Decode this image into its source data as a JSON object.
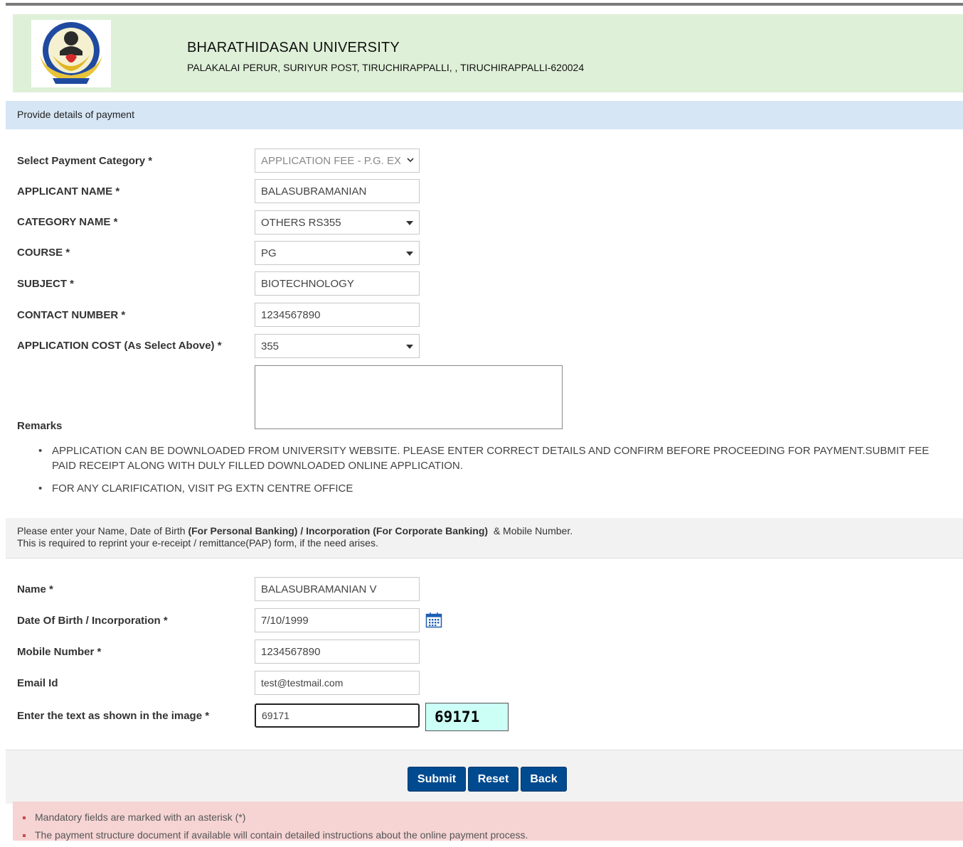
{
  "header": {
    "university_name": "BHARATHIDASAN UNIVERSITY",
    "address": "PALAKALAI PERUR, SURIYUR POST, TIRUCHIRAPPALLI, , TIRUCHIRAPPALLI-620024"
  },
  "section_title": "Provide details of payment",
  "payment_form": {
    "payment_category": {
      "label": "Select Payment Category *",
      "value": "APPLICATION FEE - P.G. EX"
    },
    "applicant_name": {
      "label": "APPLICANT NAME *",
      "value": "BALASUBRAMANIAN"
    },
    "category_name": {
      "label": "CATEGORY NAME *",
      "value": "OTHERS RS355"
    },
    "course": {
      "label": "COURSE *",
      "value": "PG"
    },
    "subject": {
      "label": "SUBJECT *",
      "value": "BIOTECHNOLOGY"
    },
    "contact_number": {
      "label": "CONTACT NUMBER *",
      "value": "1234567890"
    },
    "application_cost": {
      "label": "APPLICATION COST (As Select Above) *",
      "value": "355"
    },
    "remarks": {
      "label": "Remarks",
      "value": ""
    }
  },
  "instructions": [
    "APPLICATION CAN BE DOWNLOADED FROM UNIVERSITY WEBSITE. PLEASE ENTER CORRECT DETAILS AND CONFIRM BEFORE PROCEEDING FOR PAYMENT.SUBMIT FEE PAID RECEIPT ALONG WITH DULY FILLED DOWNLOADED ONLINE APPLICATION.",
    "FOR ANY CLARIFICATION, VISIT PG EXTN CENTRE OFFICE"
  ],
  "info": {
    "line1_start": "Please enter your Name, Date of Birth ",
    "line1_bold": "(For Personal Banking) / Incorporation (For Corporate Banking)",
    "line1_end": "  & Mobile Number.",
    "line2": "This is required to reprint your e-receipt / remittance(PAP) form, if the need arises."
  },
  "personal_form": {
    "name": {
      "label": "Name *",
      "value": "BALASUBRAMANIAN V"
    },
    "dob": {
      "label": "Date Of Birth / Incorporation *",
      "value": "7/10/1999",
      "icon": "calendar-icon"
    },
    "mobile": {
      "label": "Mobile Number *",
      "value": "1234567890"
    },
    "email": {
      "label": "Email Id",
      "value": "test@testmail.com"
    },
    "captcha": {
      "label": "Enter the text as shown in the image *",
      "value": "69171",
      "image_text": "69171"
    }
  },
  "buttons": {
    "submit": "Submit",
    "reset": "Reset",
    "back": "Back"
  },
  "notes": [
    "Mandatory fields are marked with an asterisk (*)",
    "The payment structure document if available will contain detailed instructions about the online payment process."
  ],
  "colors": {
    "header_bg": "#dff0d8",
    "section_bg": "#d6e6f5",
    "button_bg": "#004a8f",
    "notes_bg": "#f6d4d4",
    "captcha_bg": "#ccfff6"
  }
}
